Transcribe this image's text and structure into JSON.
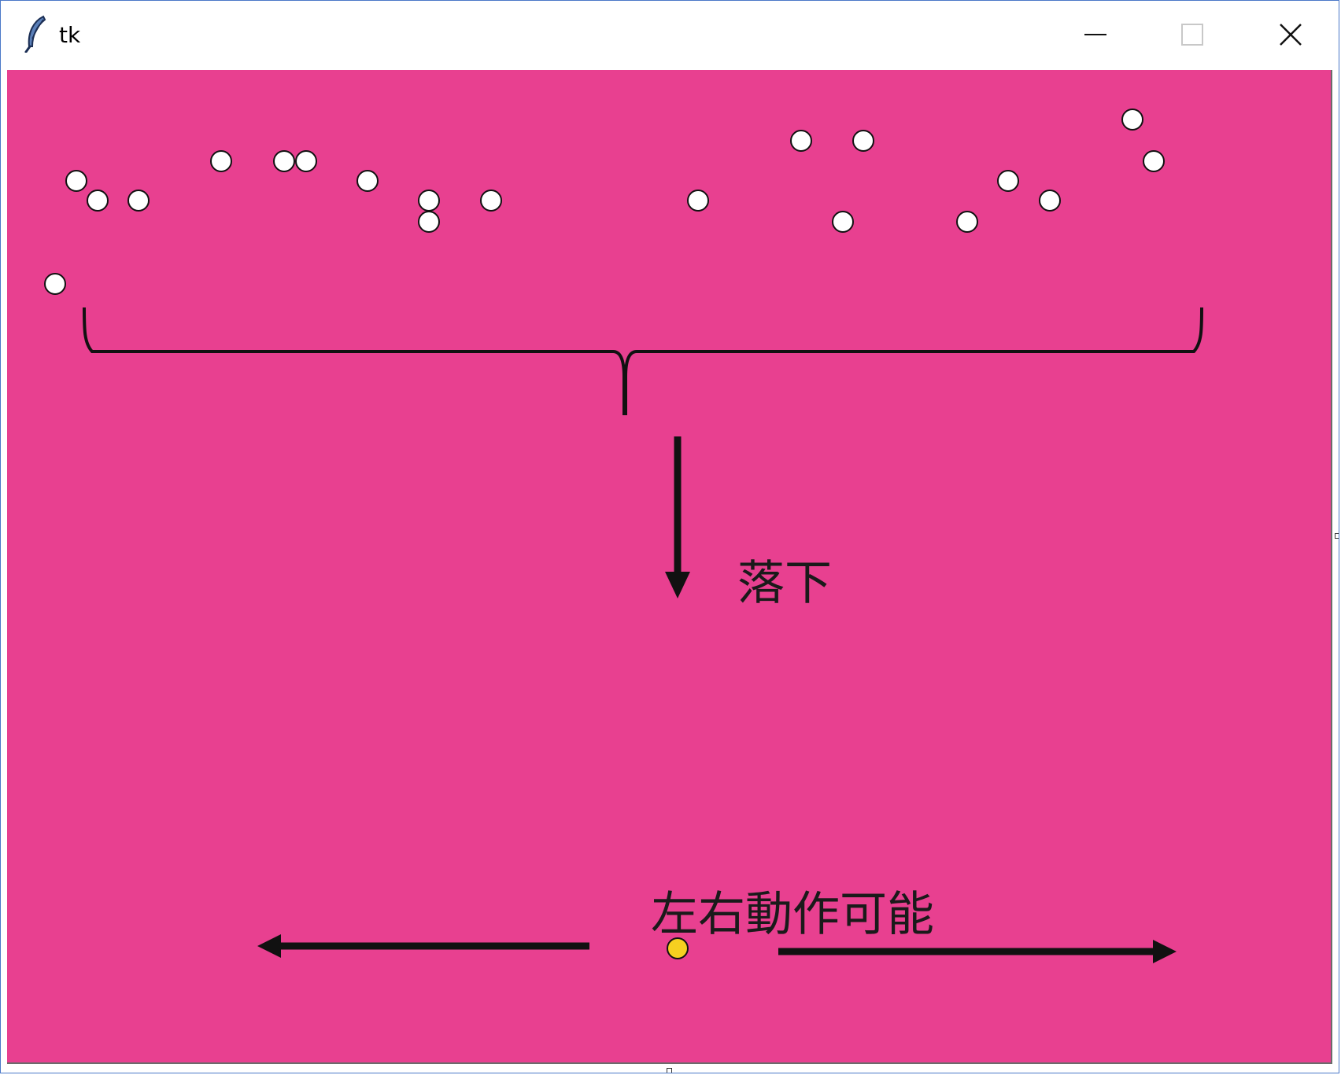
{
  "window": {
    "title": "tk",
    "icon": "feather-icon",
    "controls": {
      "minimize": "minimize-icon",
      "maximize": "maximize-icon",
      "close": "close-icon"
    }
  },
  "canvas": {
    "background_color": "#e84090",
    "labels": {
      "drop": "落下",
      "move": "左右動作可能"
    },
    "ball_color": "#ffffff",
    "player_color": "#f5d020",
    "stroke_color": "#111111",
    "annotations": {
      "brace": "brace-icon",
      "down_arrow": "arrow-down-icon",
      "left_arrow": "arrow-left-icon",
      "right_arrow": "arrow-right-icon"
    }
  }
}
